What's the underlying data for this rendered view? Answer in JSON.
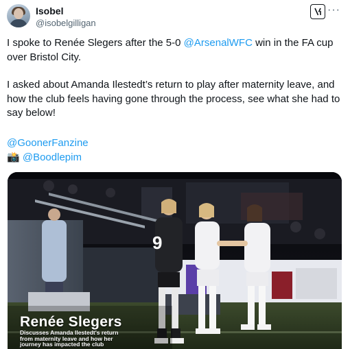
{
  "author": {
    "name": "Isobel",
    "handle": "@isobelgilligan"
  },
  "header_icons": {
    "grok": "grok-icon",
    "more": "···"
  },
  "tweet": {
    "line1_pre": "I spoke to Renée Slegers after the 5-0 ",
    "line1_mention": "@ArsenalWFC",
    "line1_post": " win in the FA cup over Bristol City.",
    "paragraph2": "I asked about Amanda Ilestedt’s return to play after maternity leave, and how the club feels having gone through the process, see what she had to say below!",
    "credit_handle": "@GoonerFanzine",
    "camera_emoji": "📸",
    "photo_handle": "@Boodlepim"
  },
  "media": {
    "overlay_title": "Renée Slegers",
    "overlay_subtitle_lines": [
      "Discusses Amanda Ilestedt's return",
      "from maternity leave and how her",
      "journey has impacted the club"
    ],
    "shirt_number": "9"
  }
}
